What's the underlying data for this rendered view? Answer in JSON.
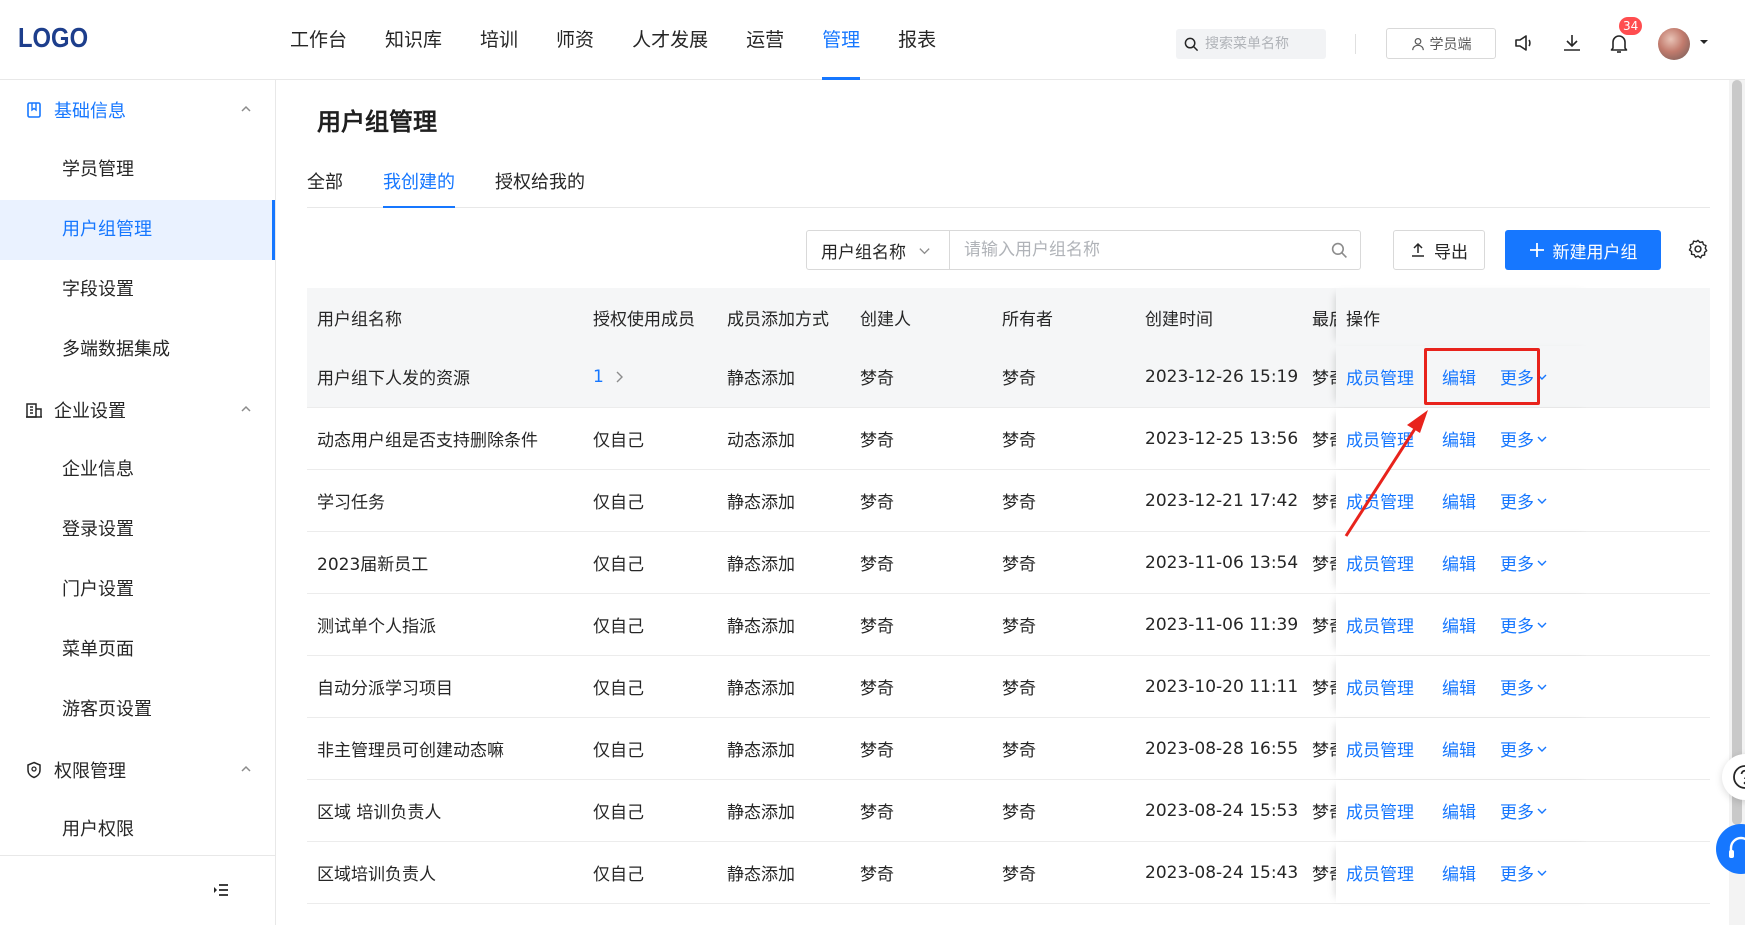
{
  "header": {
    "logo": "LOGO",
    "nav": [
      "工作台",
      "知识库",
      "培训",
      "师资",
      "人才发展",
      "运营",
      "管理",
      "报表"
    ],
    "active_nav": "管理",
    "search_placeholder": "搜索菜单名称",
    "student_label": "学员端",
    "notification_count": "34"
  },
  "sidebar": {
    "groups": [
      {
        "label": "基础信息",
        "icon": "book-icon",
        "items": [
          "学员管理",
          "用户组管理",
          "字段设置",
          "多端数据集成"
        ]
      },
      {
        "label": "企业设置",
        "icon": "building-icon",
        "items": [
          "企业信息",
          "登录设置",
          "门户设置",
          "菜单页面",
          "游客页设置"
        ]
      },
      {
        "label": "权限管理",
        "icon": "shield-icon",
        "items": [
          "用户权限"
        ]
      }
    ],
    "active_item": "用户组管理"
  },
  "main": {
    "title": "用户组管理",
    "tabs": [
      "全部",
      "我创建的",
      "授权给我的"
    ],
    "active_tab": "我创建的",
    "filter": {
      "field": "用户组名称",
      "placeholder": "请输入用户组名称"
    },
    "export_label": "导出",
    "new_label": "新建用户组"
  },
  "table": {
    "columns": [
      "用户组名称",
      "授权使用成员",
      "成员添加方式",
      "创建人",
      "所有者",
      "创建时间",
      "最后",
      "操作"
    ],
    "rows": [
      {
        "name": "用户组下人发的资源",
        "auth": "1",
        "mode": "静态添加",
        "creator": "梦奇",
        "owner": "梦奇",
        "time": "2023-12-26 15:19",
        "last": "梦奇"
      },
      {
        "name": "动态用户组是否支持删除条件",
        "auth": "仅自己",
        "mode": "动态添加",
        "creator": "梦奇",
        "owner": "梦奇",
        "time": "2023-12-25 13:56",
        "last": "梦奇"
      },
      {
        "name": "学习任务",
        "auth": "仅自己",
        "mode": "静态添加",
        "creator": "梦奇",
        "owner": "梦奇",
        "time": "2023-12-21 17:42",
        "last": "梦奇"
      },
      {
        "name": "2023届新员工",
        "auth": "仅自己",
        "mode": "静态添加",
        "creator": "梦奇",
        "owner": "梦奇",
        "time": "2023-11-06 13:54",
        "last": "梦奇"
      },
      {
        "name": "测试单个人指派",
        "auth": "仅自己",
        "mode": "静态添加",
        "creator": "梦奇",
        "owner": "梦奇",
        "time": "2023-11-06 11:39",
        "last": "梦奇"
      },
      {
        "name": "自动分派学习项目",
        "auth": "仅自己",
        "mode": "静态添加",
        "creator": "梦奇",
        "owner": "梦奇",
        "time": "2023-10-20 11:11",
        "last": "梦奇"
      },
      {
        "name": "非主管理员可创建动态嘛",
        "auth": "仅自己",
        "mode": "静态添加",
        "creator": "梦奇",
        "owner": "梦奇",
        "time": "2023-08-28 16:55",
        "last": "梦奇"
      },
      {
        "name": "区域 培训负责人",
        "auth": "仅自己",
        "mode": "静态添加",
        "creator": "梦奇",
        "owner": "梦奇",
        "time": "2023-08-24 15:53",
        "last": "梦奇"
      },
      {
        "name": "区域培训负责人",
        "auth": "仅自己",
        "mode": "静态添加",
        "creator": "梦奇",
        "owner": "梦奇",
        "time": "2023-08-24 15:43",
        "last": "梦奇"
      }
    ],
    "actions": {
      "member": "成员管理",
      "edit": "编辑",
      "more": "更多"
    }
  },
  "colors": {
    "accent": "#1677ff",
    "highlight": "#e8231c"
  }
}
